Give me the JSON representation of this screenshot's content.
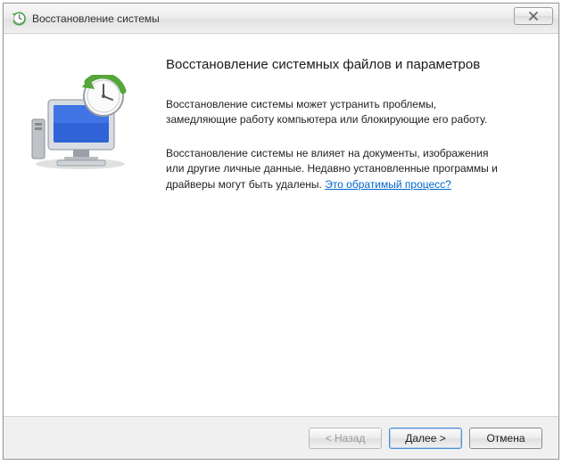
{
  "titlebar": {
    "title": "Восстановление системы"
  },
  "content": {
    "heading": "Восстановление системных файлов и параметров",
    "para1": "Восстановление системы может устранить проблемы, замедляющие работу компьютера или блокирующие его работу.",
    "para2_before_link": "Восстановление системы не влияет на документы, изображения или другие личные данные. Недавно установленные программы и драйверы могут быть удалены. ",
    "para2_link": "Это обратимый процесс?"
  },
  "buttons": {
    "back": "< Назад",
    "next": "Далее >",
    "cancel": "Отмена"
  }
}
